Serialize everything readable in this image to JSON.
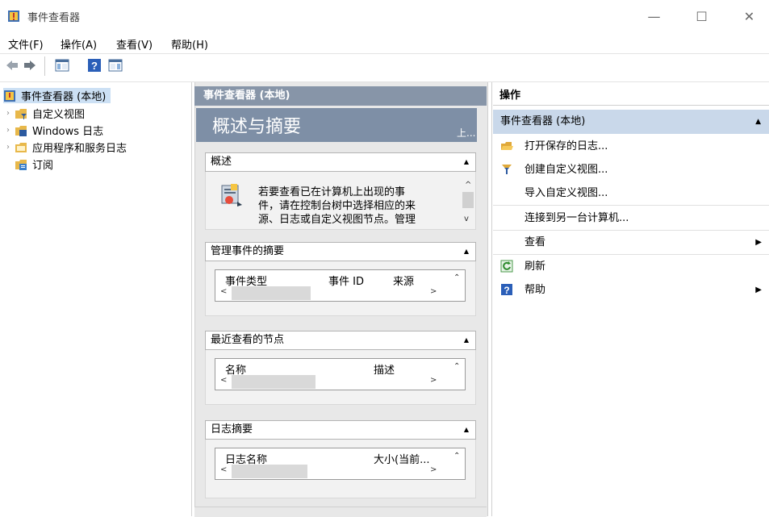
{
  "window": {
    "title": "事件查看器",
    "minimize": "—",
    "maximize": "☐",
    "close": "✕"
  },
  "menu": [
    "文件(F)",
    "操作(A)",
    "查看(V)",
    "帮助(H)"
  ],
  "tree": {
    "root": "事件查看器 (本地)",
    "items": [
      "自定义视图",
      "Windows 日志",
      "应用程序和服务日志",
      "订阅"
    ]
  },
  "middle": {
    "header": "事件查看器 (本地)",
    "banner_title": "概述与摘要",
    "banner_link": "上...",
    "sections": [
      {
        "title": "概述",
        "text": "若要查看已在计算机上出现的事件，请在控制台树中选择相应的来源、日志或自定义视图节点。管理"
      },
      {
        "title": "管理事件的摘要",
        "columns": [
          "事件类型",
          "事件 ID",
          "来源"
        ]
      },
      {
        "title": "最近查看的节点",
        "columns": [
          "名称",
          "描述"
        ]
      },
      {
        "title": "日志摘要",
        "columns": [
          "日志名称",
          "大小(当前..."
        ]
      }
    ],
    "overview_lines": [
      "若要查看已在计算机上出现的事",
      "件，请在控制台树中选择相应的来",
      "源、日志或自定义视图节点。管理"
    ]
  },
  "actions": {
    "header": "操作",
    "subheader": "事件查看器 (本地)",
    "items": [
      {
        "label": "打开保存的日志...",
        "icon": "folder-open-icon"
      },
      {
        "label": "创建自定义视图...",
        "icon": "filter-icon"
      },
      {
        "label": "导入自定义视图...",
        "icon": ""
      },
      {
        "label": "连接到另一台计算机...",
        "icon": ""
      },
      {
        "label": "查看",
        "icon": "",
        "submenu": true
      },
      {
        "label": "刷新",
        "icon": "refresh-icon"
      },
      {
        "label": "帮助",
        "icon": "help-icon",
        "submenu": true
      }
    ]
  },
  "colors": {
    "header_bg": "#8795a8",
    "banner_bg": "#7e8fa6",
    "action_selected": "#c9d8ea"
  }
}
